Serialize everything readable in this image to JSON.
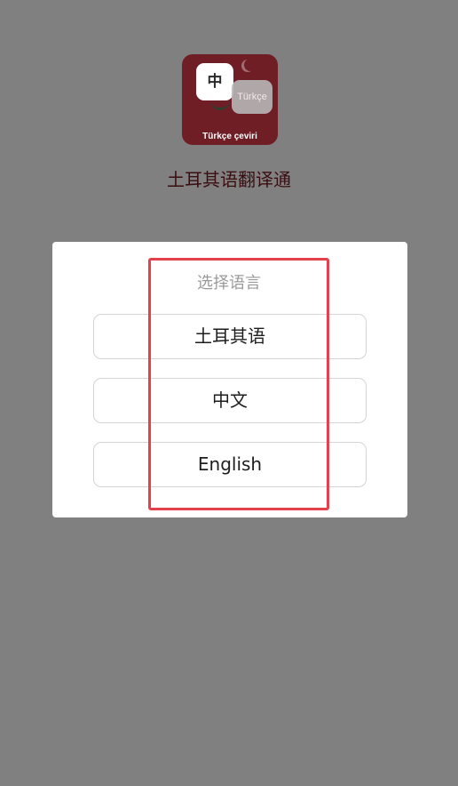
{
  "app": {
    "logo": {
      "zh_glyph": "中",
      "tr_label": "Türkçe",
      "caption": "Türkçe çeviri",
      "bg_color": "#6f1e26"
    },
    "title": "土耳其语翻译通"
  },
  "dialog": {
    "title": "选择语言",
    "options": [
      {
        "label": "土耳其语"
      },
      {
        "label": "中文"
      },
      {
        "label": "English"
      }
    ]
  },
  "colors": {
    "overlay": "#808080",
    "highlight": "#e5404b",
    "title_text": "#3a0d10"
  }
}
